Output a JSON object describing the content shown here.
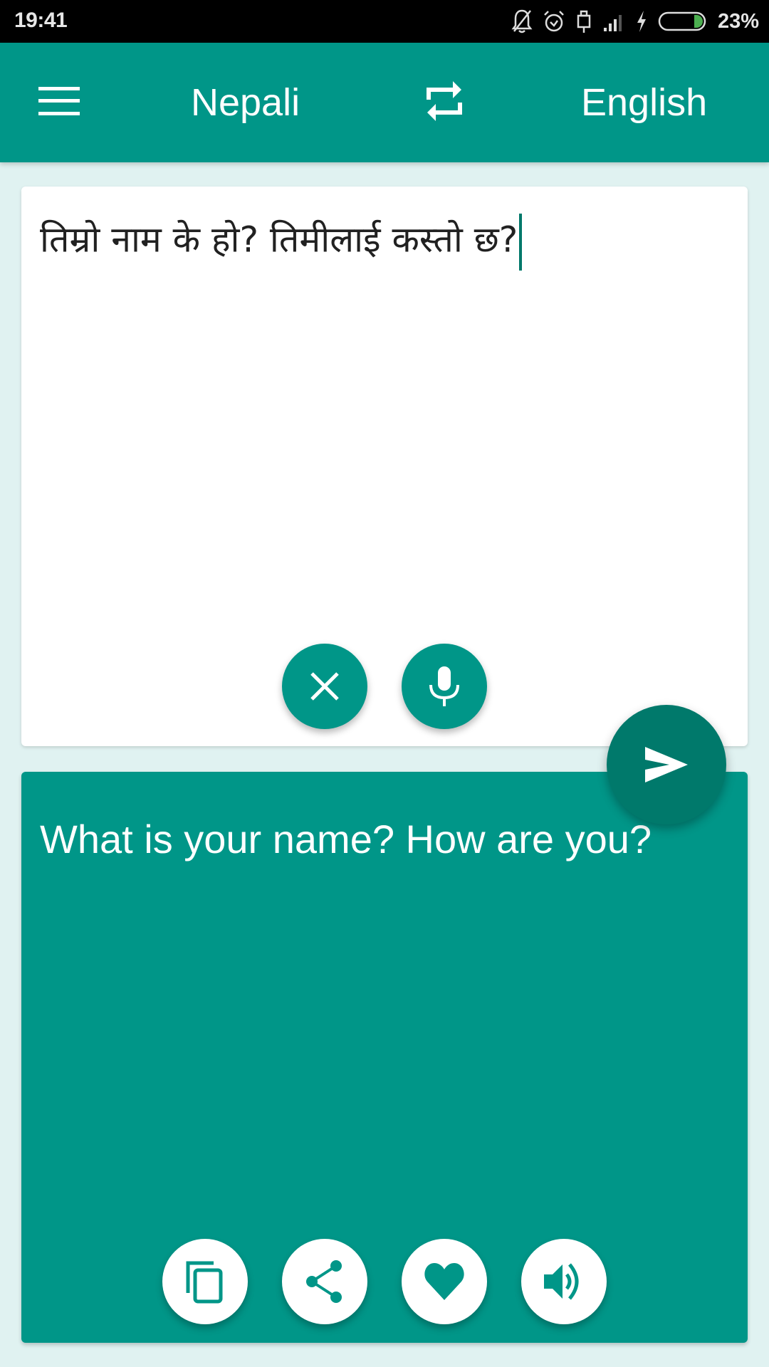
{
  "status_bar": {
    "time": "19:41",
    "battery_percent": "23%",
    "battery_level": 0.23,
    "icons": [
      "notifications-off-icon",
      "alarm-icon",
      "usb-lock-icon",
      "signal-icon",
      "charging-icon",
      "battery-icon"
    ]
  },
  "app_bar": {
    "menu_icon": "menu-icon",
    "source_language": "Nepali",
    "swap_icon": "swap-icon",
    "target_language": "English"
  },
  "input": {
    "text": "तिम्रो नाम के हो? तिमीलाई कस्तो छ?",
    "clear_icon": "close-icon",
    "mic_icon": "microphone-icon"
  },
  "send": {
    "icon": "send-icon"
  },
  "output": {
    "text": "What is your name? How are you?",
    "actions": [
      {
        "name": "copy",
        "icon": "copy-icon"
      },
      {
        "name": "share",
        "icon": "share-icon"
      },
      {
        "name": "favorite",
        "icon": "heart-icon"
      },
      {
        "name": "speak",
        "icon": "volume-icon"
      }
    ]
  },
  "colors": {
    "primary": "#009688",
    "primary_dark": "#00796B",
    "background": "#E0F2F1",
    "battery_green": "#4CAF50"
  }
}
